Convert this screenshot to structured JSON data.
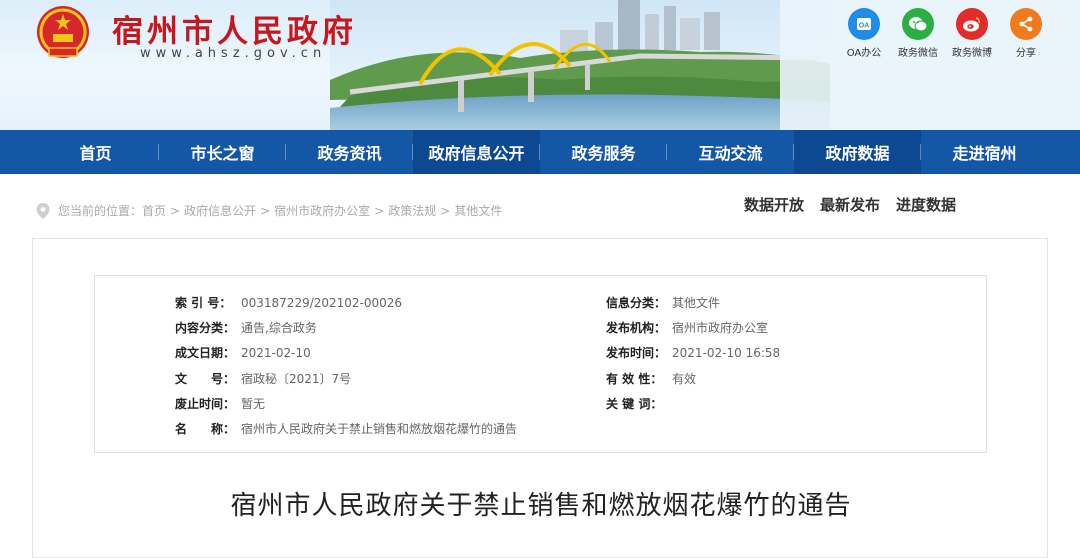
{
  "header": {
    "site_title": "宿州市人民政府",
    "site_url": "www.ahsz.gov.cn",
    "quick_links": [
      {
        "label": "OA办公",
        "icon": "oa-icon",
        "color": "#1f8ce6"
      },
      {
        "label": "政务微信",
        "icon": "wechat-icon",
        "color": "#2aae45"
      },
      {
        "label": "政务微博",
        "icon": "weibo-icon",
        "color": "#e32b2b"
      },
      {
        "label": "分享",
        "icon": "share-icon",
        "color": "#f07b1d"
      }
    ]
  },
  "nav": {
    "items": [
      "首页",
      "市长之窗",
      "政务资讯",
      "政府信息公开",
      "政务服务",
      "互动交流",
      "政府数据",
      "走进宿州"
    ],
    "active": [
      "政府信息公开",
      "政府数据"
    ]
  },
  "breadcrumb": {
    "prefix": "您当前的位置：",
    "items": [
      "首页",
      "政府信息公开",
      "宿州市政府办公室",
      "政策法规",
      "其他文件"
    ],
    "separator": ">"
  },
  "subtabs": [
    "数据开放",
    "最新发布",
    "进度数据"
  ],
  "info": {
    "left": [
      {
        "key": "索 引 号：",
        "value": "003187229/202102-00026"
      },
      {
        "key": "内容分类：",
        "value": "通告,综合政务"
      },
      {
        "key": "成文日期：",
        "value": "2021-02-10"
      },
      {
        "key": "文　　号：",
        "value": "宿政秘〔2021〕7号"
      },
      {
        "key": "废止时间：",
        "value": "暂无"
      },
      {
        "key": "名　　称：",
        "value": "宿州市人民政府关于禁止销售和燃放烟花爆竹的通告"
      }
    ],
    "right": [
      {
        "key": "信息分类：",
        "value": "其他文件"
      },
      {
        "key": "发布机构：",
        "value": "宿州市政府办公室"
      },
      {
        "key": "发布时间：",
        "value": "2021-02-10 16:58"
      },
      {
        "key": "有 效 性：",
        "value": "有效"
      },
      {
        "key": "关 键 词：",
        "value": ""
      }
    ]
  },
  "document": {
    "title": "宿州市人民政府关于禁止销售和燃放烟花爆竹的通告"
  },
  "colors": {
    "brand_red": "#c8161d",
    "nav_blue": "#1457a6",
    "nav_active": "#0d4893"
  }
}
